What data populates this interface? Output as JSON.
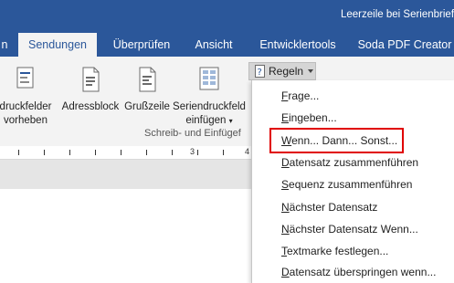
{
  "window": {
    "title": "Leerzeile bei Serienbrief"
  },
  "tabs": [
    {
      "label": "n"
    },
    {
      "label": "Sendungen",
      "active": true
    },
    {
      "label": "Überprüfen"
    },
    {
      "label": "Ansicht"
    },
    {
      "label": "Entwicklertools"
    },
    {
      "label": "Soda PDF Creator"
    }
  ],
  "ribbon": {
    "buttons": {
      "highlight_fields": {
        "line1": "druckfelder",
        "line2": "vorheben",
        "icon": "highlight-merge-fields-icon"
      },
      "address_block": {
        "label": "Adressblock",
        "icon": "address-block-icon"
      },
      "greeting_line": {
        "label": "Grußzeile",
        "icon": "greeting-line-icon"
      },
      "insert_merge_field": {
        "line1": "Seriendruckfeld",
        "line2": "einfügen",
        "icon": "insert-merge-field-icon"
      }
    },
    "group_label": "Schreib- und Einfügef",
    "rules_button": {
      "label": "Regeln",
      "icon": "rules-icon"
    }
  },
  "ruler": {
    "label_3": "3",
    "label_4": "4"
  },
  "rules_menu": {
    "items": [
      {
        "u": "F",
        "rest": "rage..."
      },
      {
        "u": "E",
        "rest": "ingeben..."
      },
      {
        "u": "W",
        "rest": "enn... Dann... Sonst...",
        "highlighted": true
      },
      {
        "u": "D",
        "rest": "atensatz zusammenführen"
      },
      {
        "u": "S",
        "rest": "equenz zusammenführen"
      },
      {
        "u": "N",
        "rest": "ächster Datensatz"
      },
      {
        "u": "N",
        "rest": "ächster Datensatz Wenn..."
      },
      {
        "u": "T",
        "rest": "extmarke festlegen..."
      },
      {
        "u": "D",
        "rest": "atensatz überspringen wenn..."
      }
    ]
  },
  "colors": {
    "accent": "#2b579a",
    "highlight_border": "#e00000",
    "ribbon_bg": "#f3f3f3"
  }
}
